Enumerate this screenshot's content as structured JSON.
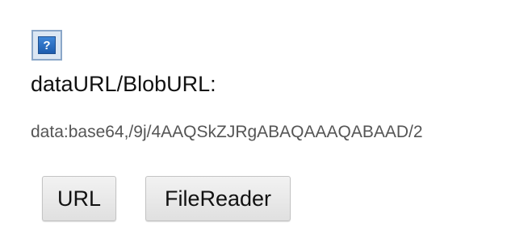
{
  "image": {
    "icon": "broken-image-question-icon",
    "glyph": "?"
  },
  "label": "dataURL/BlobURL:",
  "url_value": "data:base64,/9j/4AAQSkZJRgABAQAAAQABAAD/2",
  "buttons": {
    "url_label": "URL",
    "filereader_label": "FileReader"
  },
  "colors": {
    "icon_blue": "#1d5cae",
    "text_gray": "#555555"
  }
}
